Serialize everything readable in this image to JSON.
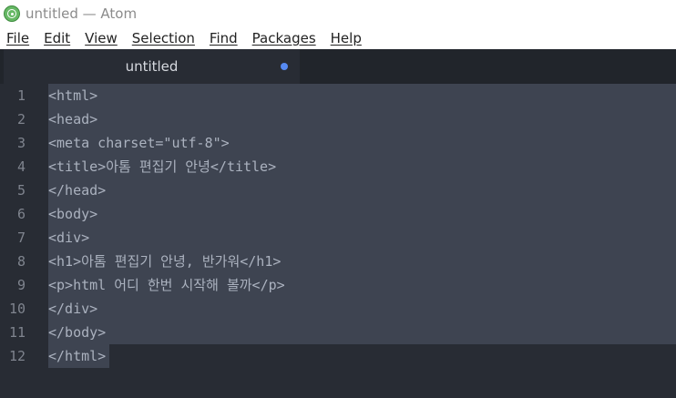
{
  "window": {
    "title": "untitled — Atom",
    "icon": "atom-icon"
  },
  "menu": [
    {
      "label": "File"
    },
    {
      "label": "Edit"
    },
    {
      "label": "View"
    },
    {
      "label": "Selection"
    },
    {
      "label": "Find"
    },
    {
      "label": "Packages"
    },
    {
      "label": "Help"
    }
  ],
  "tab": {
    "title": "untitled",
    "modified_indicator_color": "#568af2"
  },
  "editor": {
    "lines": [
      {
        "number": "1",
        "text": "<html>"
      },
      {
        "number": "2",
        "text": "<head>"
      },
      {
        "number": "3",
        "text": "<meta charset=\"utf-8\">"
      },
      {
        "number": "4",
        "text": "<title>아톰 편집기 안녕</title>"
      },
      {
        "number": "5",
        "text": "</head>"
      },
      {
        "number": "6",
        "text": "<body>"
      },
      {
        "number": "7",
        "text": "<div>"
      },
      {
        "number": "8",
        "text": "<h1>아톰 편집기 안녕, 반가워</h1>"
      },
      {
        "number": "9",
        "text": "<p>html 어디 한번 시작해 볼까</p>"
      },
      {
        "number": "10",
        "text": "</div>"
      },
      {
        "number": "11",
        "text": "</body>"
      },
      {
        "number": "12",
        "text": "</html>"
      }
    ]
  },
  "colors": {
    "editor_background": "#282c34",
    "selection": "#3e4451",
    "tab_bar": "#21252b"
  }
}
